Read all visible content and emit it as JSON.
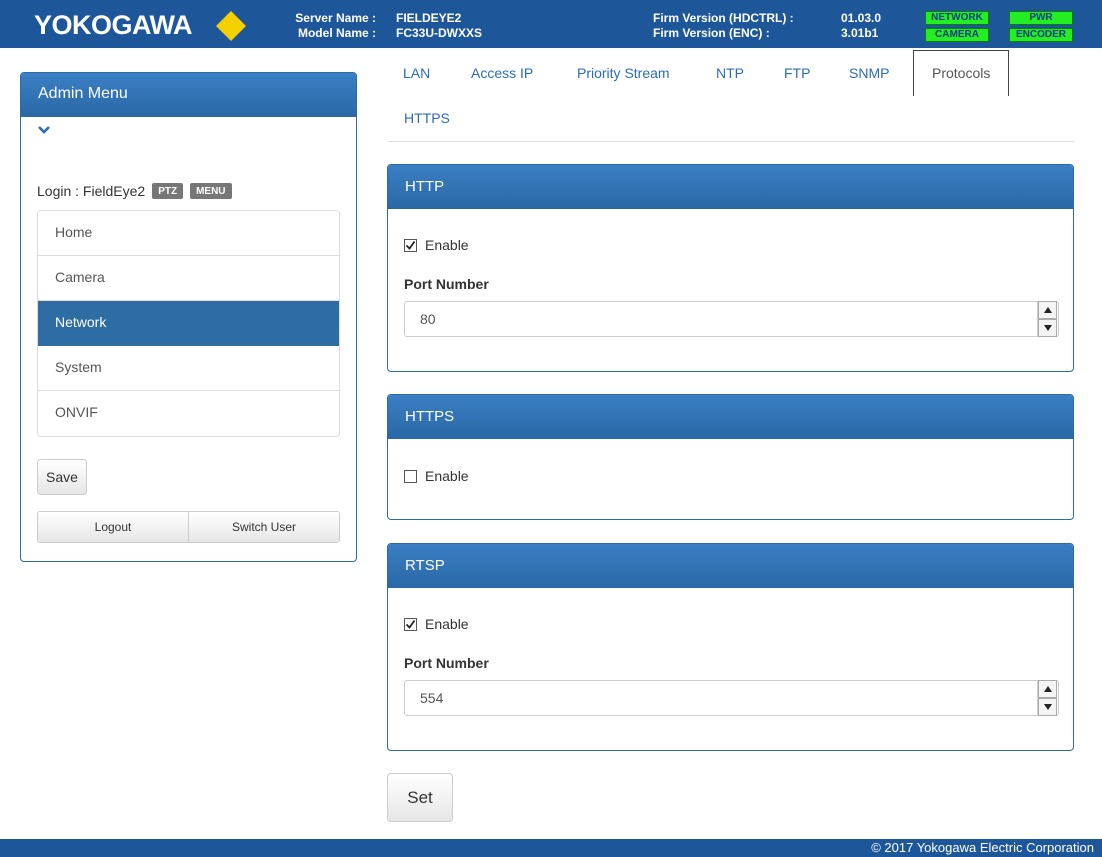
{
  "header": {
    "logo_text": "YOKOGAWA",
    "server_name_label": "Server Name :",
    "model_name_label": "Model Name :",
    "server_name": "FIELDEYE2",
    "model_name": "FC33U-DWXXS",
    "firm_hdctrl_label": "Firm Version (HDCTRL) :",
    "firm_enc_label": "Firm Version (ENC) :",
    "firm_hdctrl": "01.03.0",
    "firm_enc": "3.01b1",
    "status": {
      "network": "NETWORK",
      "camera": "CAMERA",
      "pwr": "PWR",
      "encoder": "ENCODER"
    }
  },
  "sidebar": {
    "title": "Admin Menu",
    "login_label": "Login : FieldEye2",
    "tags": [
      "PTZ",
      "MENU"
    ],
    "items": [
      {
        "label": "Home"
      },
      {
        "label": "Camera"
      },
      {
        "label": "Network",
        "active": true
      },
      {
        "label": "System"
      },
      {
        "label": "ONVIF"
      }
    ],
    "save_label": "Save",
    "logout_label": "Logout",
    "switch_user_label": "Switch User"
  },
  "tabs": [
    "LAN",
    "Access IP",
    "Priority Stream",
    "NTP",
    "FTP",
    "SNMP",
    "Protocols",
    "HTTPS"
  ],
  "active_tab": "Protocols",
  "panels": {
    "http": {
      "title": "HTTP",
      "enable_label": "Enable",
      "enabled": true,
      "port_label": "Port Number",
      "port_value": "80"
    },
    "https": {
      "title": "HTTPS",
      "enable_label": "Enable",
      "enabled": false
    },
    "rtsp": {
      "title": "RTSP",
      "enable_label": "Enable",
      "enabled": true,
      "port_label": "Port Number",
      "port_value": "554"
    }
  },
  "set_label": "Set",
  "footer": "© 2017 Yokogawa Electric Corporation",
  "colors": {
    "primary": "#1e5799",
    "panel_header": "#2a68a6",
    "status_green": "#22ee22",
    "link": "#2a6db5"
  }
}
